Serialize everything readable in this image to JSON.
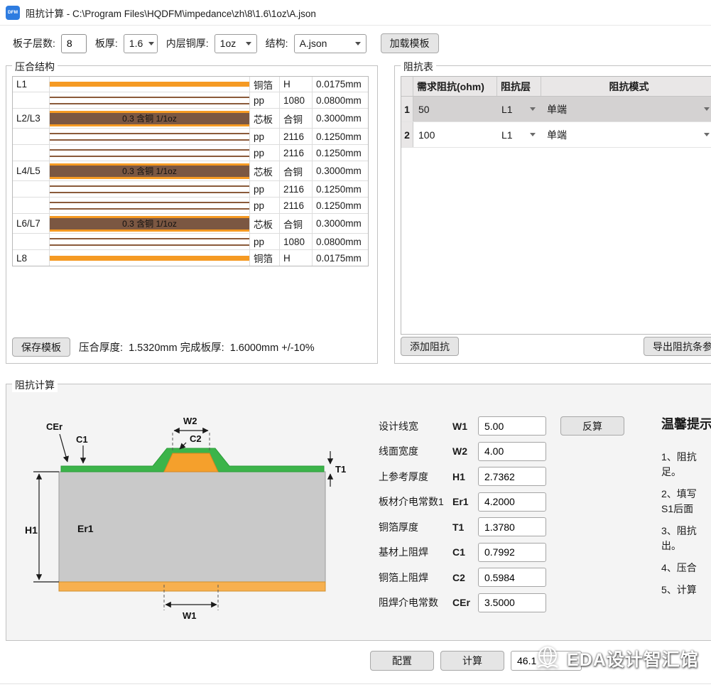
{
  "window": {
    "icon_label": "DFM",
    "title": "阻抗计算 - C:\\Program Files\\HQDFM\\impedance\\zh\\8\\1.6\\1oz\\A.json"
  },
  "toolbar": {
    "layers_label": "板子层数:",
    "layers_value": "8",
    "thickness_label": "板厚:",
    "thickness_value": "1.6",
    "copper_label": "内层铜厚:",
    "copper_value": "1oz",
    "structure_label": "结构:",
    "structure_value": "A.json",
    "load_template": "加载模板"
  },
  "stackup": {
    "title": "压合结构",
    "rows": [
      {
        "layer": "L1",
        "type": "copper",
        "bar_text": "",
        "name": "铜箔",
        "material": "H",
        "thickness": "0.0175mm"
      },
      {
        "layer": "",
        "type": "pp",
        "bar_text": "",
        "name": "pp",
        "material": "1080",
        "thickness": "0.0800mm"
      },
      {
        "layer": "L2/L3",
        "type": "core",
        "bar_text": "0.3 含铜 1/1oz",
        "name": "芯板",
        "material": "合铜",
        "thickness": "0.3000mm"
      },
      {
        "layer": "",
        "type": "pp",
        "bar_text": "",
        "name": "pp",
        "material": "2116",
        "thickness": "0.1250mm"
      },
      {
        "layer": "",
        "type": "pp",
        "bar_text": "",
        "name": "pp",
        "material": "2116",
        "thickness": "0.1250mm"
      },
      {
        "layer": "L4/L5",
        "type": "core",
        "bar_text": "0.3 含铜 1/1oz",
        "name": "芯板",
        "material": "合铜",
        "thickness": "0.3000mm"
      },
      {
        "layer": "",
        "type": "pp",
        "bar_text": "",
        "name": "pp",
        "material": "2116",
        "thickness": "0.1250mm"
      },
      {
        "layer": "",
        "type": "pp",
        "bar_text": "",
        "name": "pp",
        "material": "2116",
        "thickness": "0.1250mm"
      },
      {
        "layer": "L6/L7",
        "type": "core",
        "bar_text": "0.3 含铜 1/1oz",
        "name": "芯板",
        "material": "合铜",
        "thickness": "0.3000mm"
      },
      {
        "layer": "",
        "type": "pp",
        "bar_text": "",
        "name": "pp",
        "material": "1080",
        "thickness": "0.0800mm"
      },
      {
        "layer": "L8",
        "type": "copper",
        "bar_text": "",
        "name": "铜箔",
        "material": "H",
        "thickness": "0.0175mm"
      }
    ],
    "save_template": "保存模板",
    "summary": "压合厚度:  1.5320mm 完成板厚:  1.6000mm +/-10%"
  },
  "impedance": {
    "title": "阻抗表",
    "headers": {
      "impedance": "需求阻抗(ohm)",
      "layer": "阻抗层",
      "mode": "阻抗模式"
    },
    "rows": [
      {
        "num": "1",
        "value": "50",
        "layer": "L1",
        "mode": "单端"
      },
      {
        "num": "2",
        "value": "100",
        "layer": "L1",
        "mode": "单端"
      }
    ],
    "add_button": "添加阻抗",
    "export_button": "导出阻抗条参数"
  },
  "calc": {
    "title": "阻抗计算",
    "diagram": {
      "w2": "W2",
      "c2": "C2",
      "cer": "CEr",
      "c1": "C1",
      "t1": "T1",
      "h1": "H1",
      "er1": "Er1",
      "w1": "W1"
    },
    "fields": [
      {
        "label": "设计线宽",
        "symbol": "W1",
        "value": "5.00"
      },
      {
        "label": "线面宽度",
        "symbol": "W2",
        "value": "4.00"
      },
      {
        "label": "上参考厚度",
        "symbol": "H1",
        "value": "2.7362"
      },
      {
        "label": "板材介电常数1",
        "symbol": "Er1",
        "value": "4.2000"
      },
      {
        "label": "铜箔厚度",
        "symbol": "T1",
        "value": "1.3780"
      },
      {
        "label": "基材上阻焊",
        "symbol": "C1",
        "value": "0.7992"
      },
      {
        "label": "铜箔上阻焊",
        "symbol": "C2",
        "value": "0.5984"
      },
      {
        "label": "阻焊介电常数",
        "symbol": "CEr",
        "value": "3.5000"
      }
    ],
    "reverse_button": "反算",
    "tips": {
      "title": "温馨提示",
      "items": [
        {
          "l1": "1、阻抗",
          "l2": "足。"
        },
        {
          "l1": "2、填写",
          "l2": "S1后面"
        },
        {
          "l1": "3、阻抗",
          "l2": "出。"
        },
        {
          "l1": "4、压合",
          "l2": ""
        },
        {
          "l1": "5、计算",
          "l2": ""
        }
      ]
    }
  },
  "bottom": {
    "config_button": "配置",
    "calc_button": "计算",
    "result_value": "46.1",
    "watermark": "EDA设计智汇馆"
  }
}
